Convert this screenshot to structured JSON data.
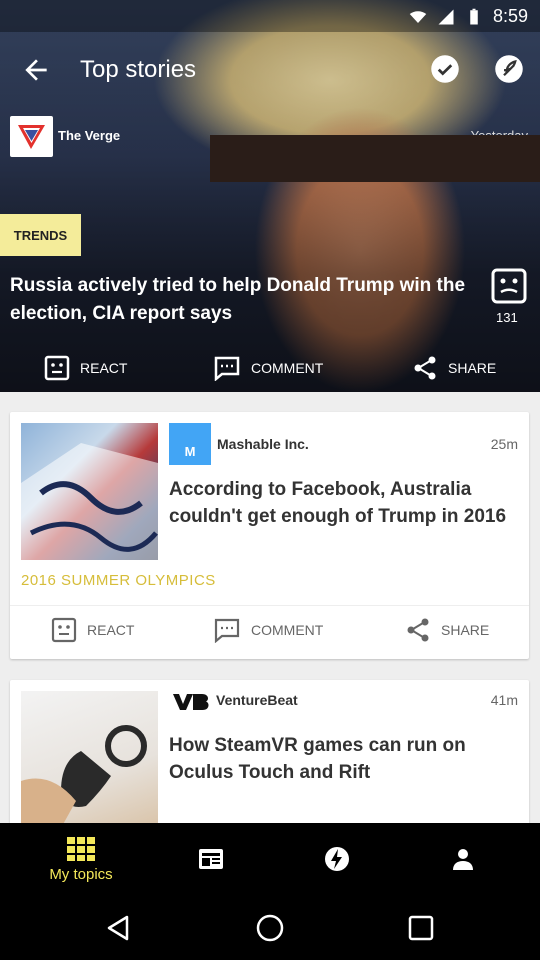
{
  "status_bar": {
    "time": "8:59"
  },
  "app_bar": {
    "title": "Top stories"
  },
  "hero": {
    "source": "The Verge",
    "time_label": "Yesterday",
    "badge": "TRENDS",
    "headline": "Russia actively tried to help Donald Trump win the election, CIA report says",
    "reaction_count": "131",
    "actions": {
      "react": "REACT",
      "comment": "COMMENT",
      "share": "SHARE"
    }
  },
  "cards": [
    {
      "publisher": "Mashable Inc.",
      "publisher_logo_text": "M",
      "time": "25m",
      "title": "According to Facebook, Australia couldn't get enough of Trump in 2016",
      "topic": "2016 SUMMER OLYMPICS",
      "actions": {
        "react": "REACT",
        "comment": "COMMENT",
        "share": "SHARE"
      }
    },
    {
      "publisher": "VentureBeat",
      "time": "41m",
      "title": "How SteamVR games can run on Oculus Touch and Rift"
    }
  ],
  "bottom_nav": {
    "items": [
      {
        "label": "My topics",
        "icon": "grid-icon"
      },
      {
        "label": "",
        "icon": "newspaper-icon"
      },
      {
        "label": "",
        "icon": "lightning-icon"
      },
      {
        "label": "",
        "icon": "person-icon"
      }
    ],
    "active_color": "#f4e85a"
  }
}
